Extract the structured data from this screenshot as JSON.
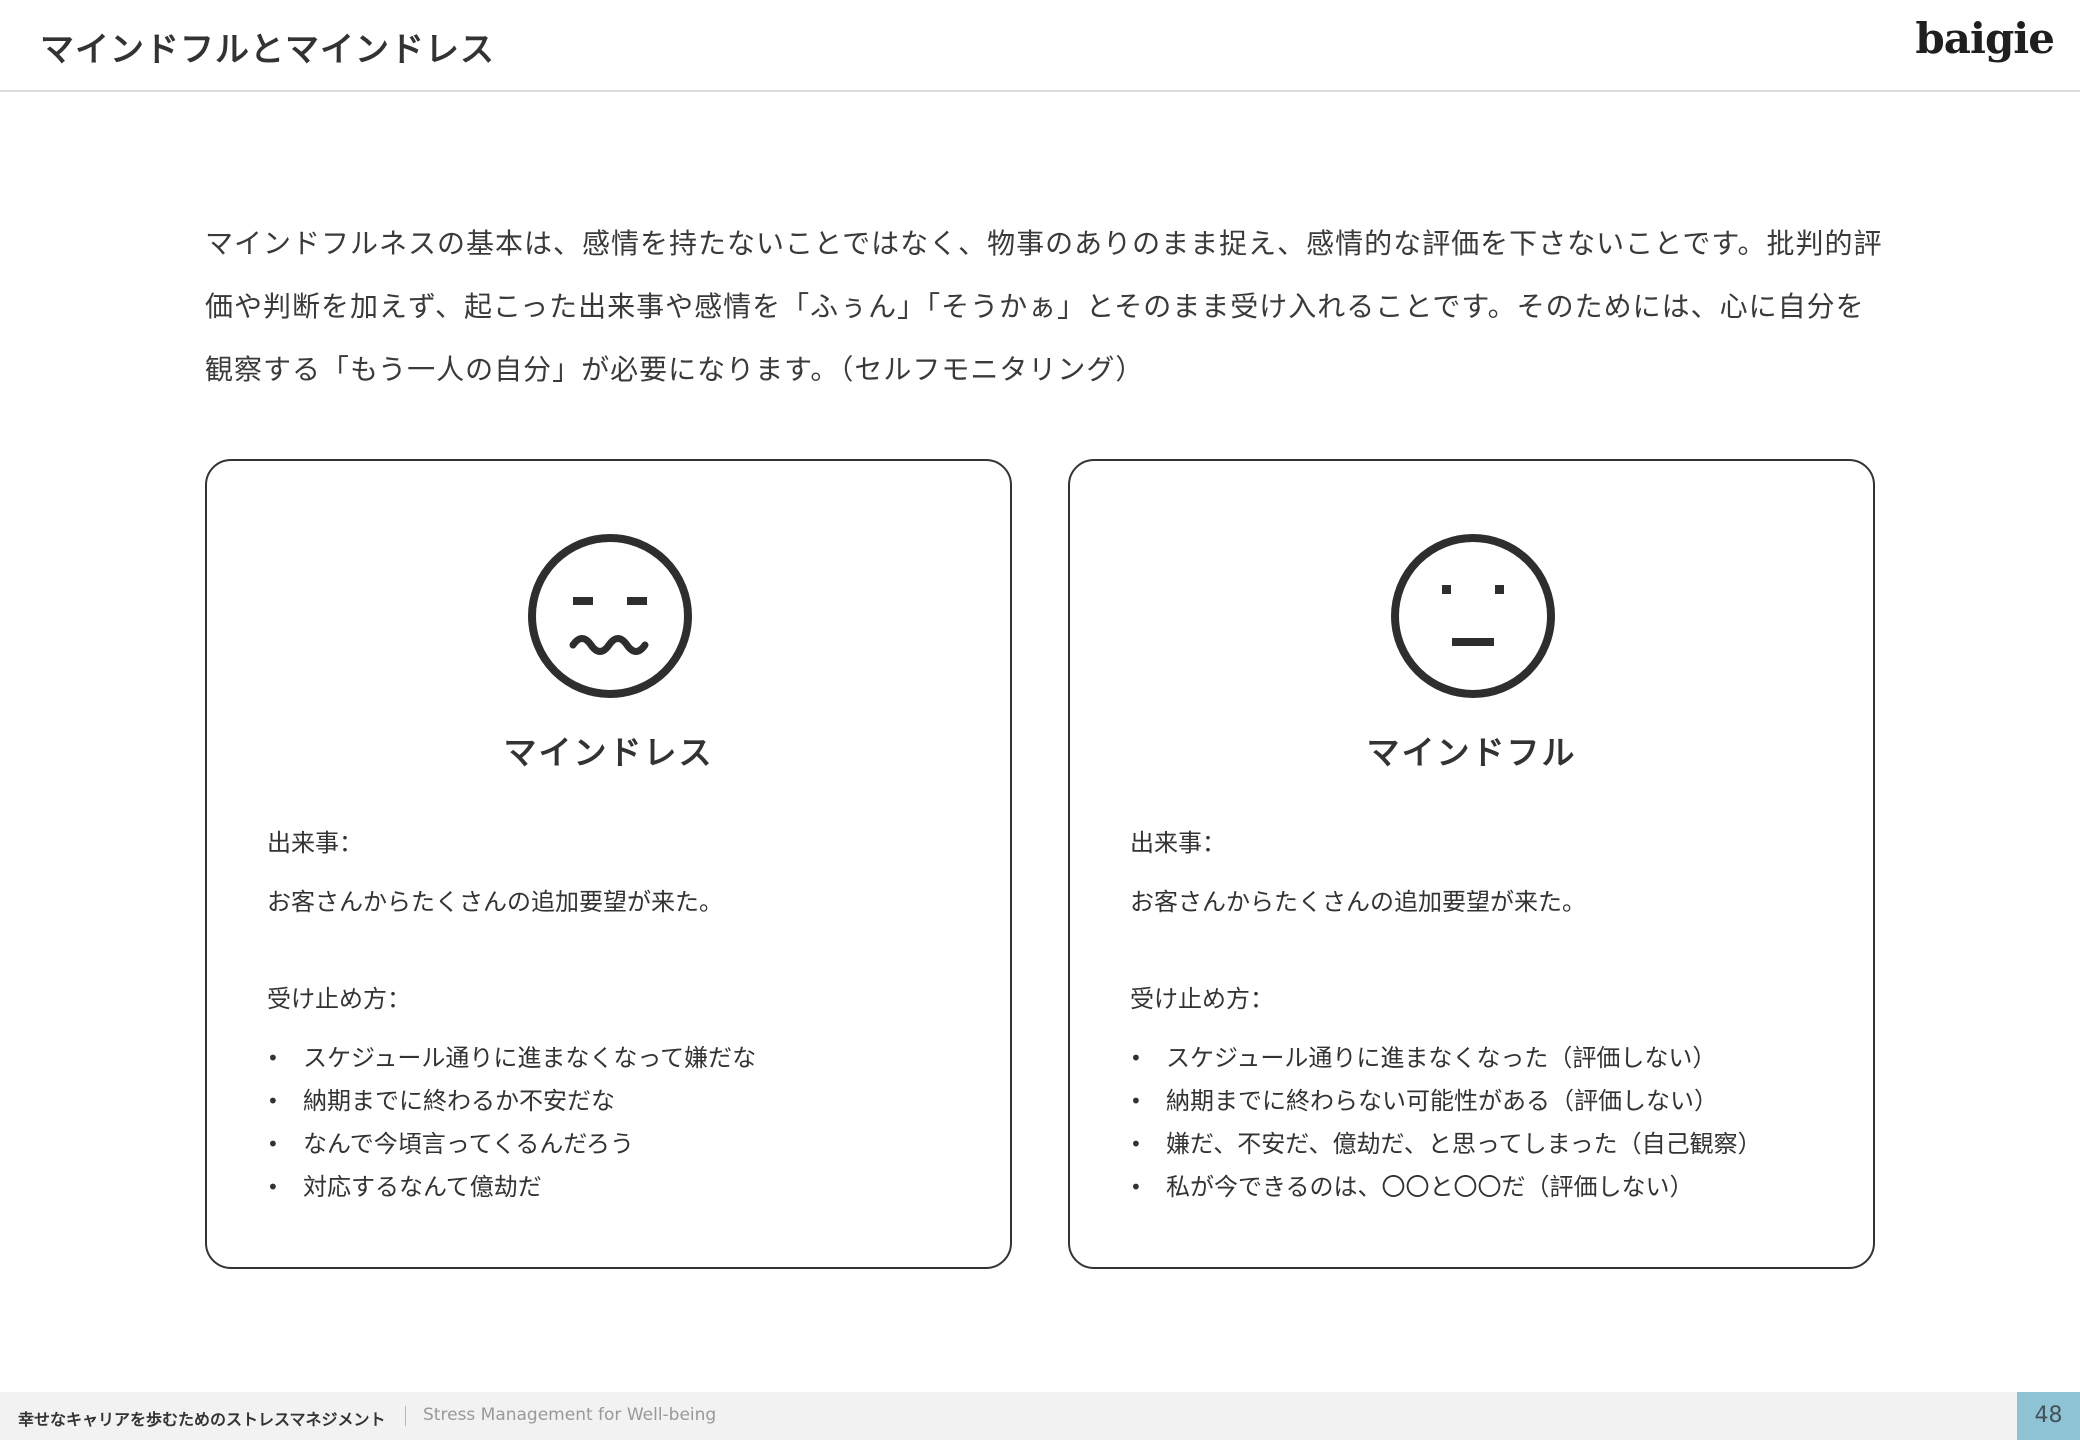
{
  "header": {
    "title": "マインドフルとマインドレス",
    "logo": "baigie"
  },
  "intro": {
    "text": "マインドフルネスの基本は、感情を持たないことではなく、物事のありのまま捉え、感情的な評価を下さないことです。批判的評価や判断を加えず、起こった出来事や感情を「ふぅん」「そうかぁ」とそのまま受け入れることです。そのためには、心に自分を観察する「もう一人の自分」が必要になります。（セルフモニタリング）"
  },
  "cards": [
    {
      "icon": "worried-face-icon",
      "title": "マインドレス",
      "event_label": "出来事：",
      "event_text": "お客さんからたくさんの追加要望が来た。",
      "reception_label": "受け止め方：",
      "items": [
        "スケジュール通りに進まなくなって嫌だな",
        "納期までに終わるか不安だな",
        "なんで今頃言ってくるんだろう",
        "対応するなんて億劫だ"
      ]
    },
    {
      "icon": "neutral-face-icon",
      "title": "マインドフル",
      "event_label": "出来事：",
      "event_text": "お客さんからたくさんの追加要望が来た。",
      "reception_label": "受け止め方：",
      "items": [
        "スケジュール通りに進まなくなった（評価しない）",
        "納期までに終わらない可能性がある（評価しない）",
        "嫌だ、不安だ、億劫だ、と思ってしまった（自己観察）",
        "私が今できるのは、〇〇と〇〇だ（評価しない）"
      ]
    }
  ],
  "footer": {
    "title": "幸せなキャリアを歩むためのストレスマネジメント",
    "subtitle": "Stress Management for Well-being",
    "page_number": "48"
  },
  "colors": {
    "text": "#333333",
    "footer_bg": "#f2f2f2",
    "page_number_bg": "#8ec3d6"
  }
}
